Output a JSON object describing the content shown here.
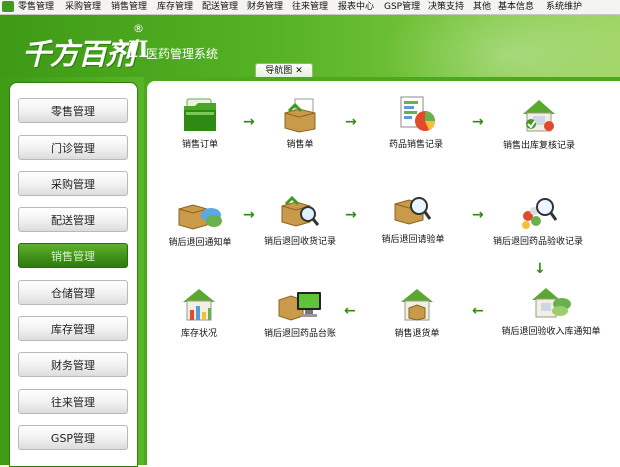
{
  "menubar": {
    "items": [
      "零售管理",
      "采购管理",
      "销售管理",
      "库存管理",
      "配送管理",
      "财务管理",
      "往来管理",
      "报表中心",
      "GSP管理",
      "决策支持",
      "其他",
      "基本信息",
      "系统维护"
    ]
  },
  "banner": {
    "logo_text": "千方百剂",
    "logo_suffix": "II",
    "registered_mark": "®",
    "system_title": "医药管理系统"
  },
  "tab": {
    "label": "导航图",
    "close_glyph": "✕"
  },
  "sidebar": {
    "active_index": 4,
    "items": [
      "零售管理",
      "门诊管理",
      "采购管理",
      "配送管理",
      "销售管理",
      "仓储管理",
      "库存管理",
      "财务管理",
      "往来管理",
      "GSP管理"
    ]
  },
  "flow": {
    "nodes": [
      "销售订单",
      "销售单",
      "药品销售记录",
      "销售出库复核记录",
      "销后退回通知单",
      "销后退回收货记录",
      "销后退回请验单",
      "销后退回药品验收记录",
      "销后退回验收入库通知单",
      "销售退货单",
      "销后退回药品台账",
      "库存状况"
    ],
    "arrow_glyphs": {
      "right": "→",
      "left": "←",
      "down": "↓"
    }
  },
  "colors": {
    "brand_green": "#4ea81f",
    "arrow_green": "#2f8a14",
    "active_button": "#3d8f17"
  }
}
